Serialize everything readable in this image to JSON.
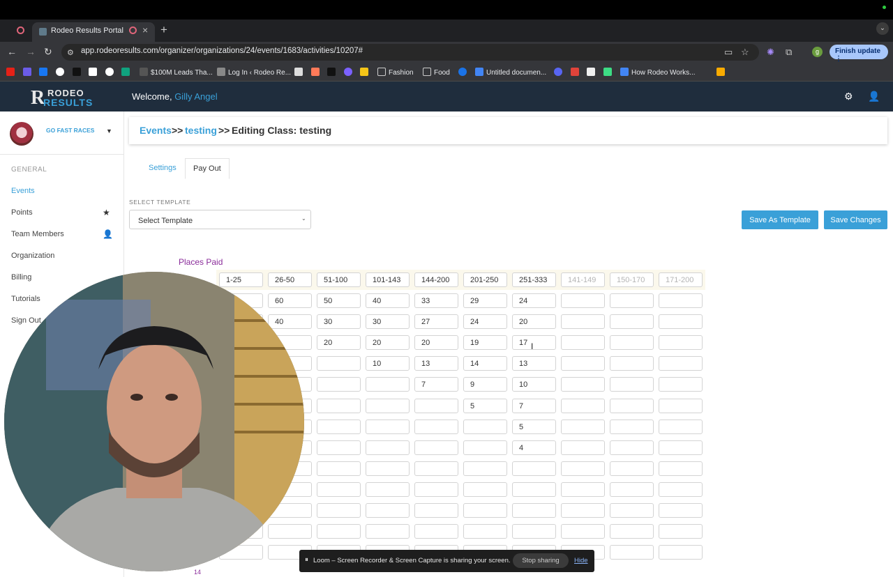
{
  "browser": {
    "tab_title": "Rodeo Results Portal",
    "new_tab": "+",
    "url": "app.rodeoresults.com/organizer/organizations/24/events/1683/activities/10207#",
    "profile_initial": "g",
    "finish_update": "Finish update",
    "bookmarks": [
      "$100M Leads Tha...",
      "Log In ‹ Rodeo Re...",
      "Fashion",
      "Food",
      "Untitled documen...",
      "How Rodeo Works..."
    ]
  },
  "app": {
    "logo_top": "RODEO",
    "logo_bottom": "RESULTS",
    "logo_letter": "R",
    "welcome_prefix": "Welcome,",
    "user_name": "Gilly Angel"
  },
  "sidebar": {
    "org_name": "GO FAST RACES",
    "section": "GENERAL",
    "items": [
      {
        "label": "Events"
      },
      {
        "label": "Points"
      },
      {
        "label": "Team Members"
      },
      {
        "label": "Organization"
      },
      {
        "label": "Billing"
      },
      {
        "label": "Tutorials"
      },
      {
        "label": "Sign Out"
      }
    ]
  },
  "breadcrumb": {
    "events": "Events",
    "sep1": ">>",
    "activity": "testing",
    "sep2": ">>",
    "current": "Editing Class: testing"
  },
  "tabs": {
    "settings": "Settings",
    "payout": "Pay Out"
  },
  "template": {
    "label": "SELECT TEMPLATE",
    "selected": "Select Template"
  },
  "buttons": {
    "save_as_template": "Save As Template",
    "save_changes": "Save Changes"
  },
  "payout": {
    "places_label": "Places Paid",
    "columns": [
      "1-25",
      "26-50",
      "51-100",
      "101-143",
      "144-200",
      "201-250",
      "251-333"
    ],
    "placeholder_columns": [
      "141-149",
      "150-170",
      "171-200"
    ],
    "rows": [
      [
        "",
        "60",
        "50",
        "40",
        "33",
        "29",
        "24",
        "",
        "",
        ""
      ],
      [
        "",
        "40",
        "30",
        "30",
        "27",
        "24",
        "20",
        "",
        "",
        ""
      ],
      [
        "",
        "",
        "20",
        "20",
        "20",
        "19",
        "17",
        "",
        "",
        ""
      ],
      [
        "",
        "",
        "",
        "10",
        "13",
        "14",
        "13",
        "",
        "",
        ""
      ],
      [
        "",
        "",
        "",
        "",
        "7",
        "9",
        "10",
        "",
        "",
        ""
      ],
      [
        "",
        "",
        "",
        "",
        "",
        "5",
        "7",
        "",
        "",
        ""
      ],
      [
        "",
        "",
        "",
        "",
        "",
        "",
        "5",
        "",
        "",
        ""
      ],
      [
        "",
        "",
        "",
        "",
        "",
        "",
        "4",
        "",
        "",
        ""
      ],
      [
        "",
        "",
        "",
        "",
        "",
        "",
        "",
        "",
        "",
        ""
      ],
      [
        "",
        "",
        "",
        "",
        "",
        "",
        "",
        "",
        "",
        ""
      ],
      [
        "",
        "",
        "",
        "",
        "",
        "",
        "",
        "",
        "",
        ""
      ],
      [
        "",
        "",
        "",
        "",
        "",
        "",
        "",
        "",
        "",
        ""
      ],
      [
        "",
        "",
        "",
        "",
        "",
        "",
        "",
        "",
        "",
        ""
      ],
      [
        "",
        "",
        "",
        "",
        "",
        "",
        "",
        "",
        "",
        ""
      ]
    ],
    "visible_row_number": "14"
  },
  "loom": {
    "message": "Loom – Screen Recorder & Screen Capture is sharing your screen.",
    "stop": "Stop sharing",
    "hide": "Hide"
  },
  "colors": {
    "accent": "#3aa0d8",
    "header_bg": "#1f2d3d",
    "places_label": "#8a2c9a"
  }
}
